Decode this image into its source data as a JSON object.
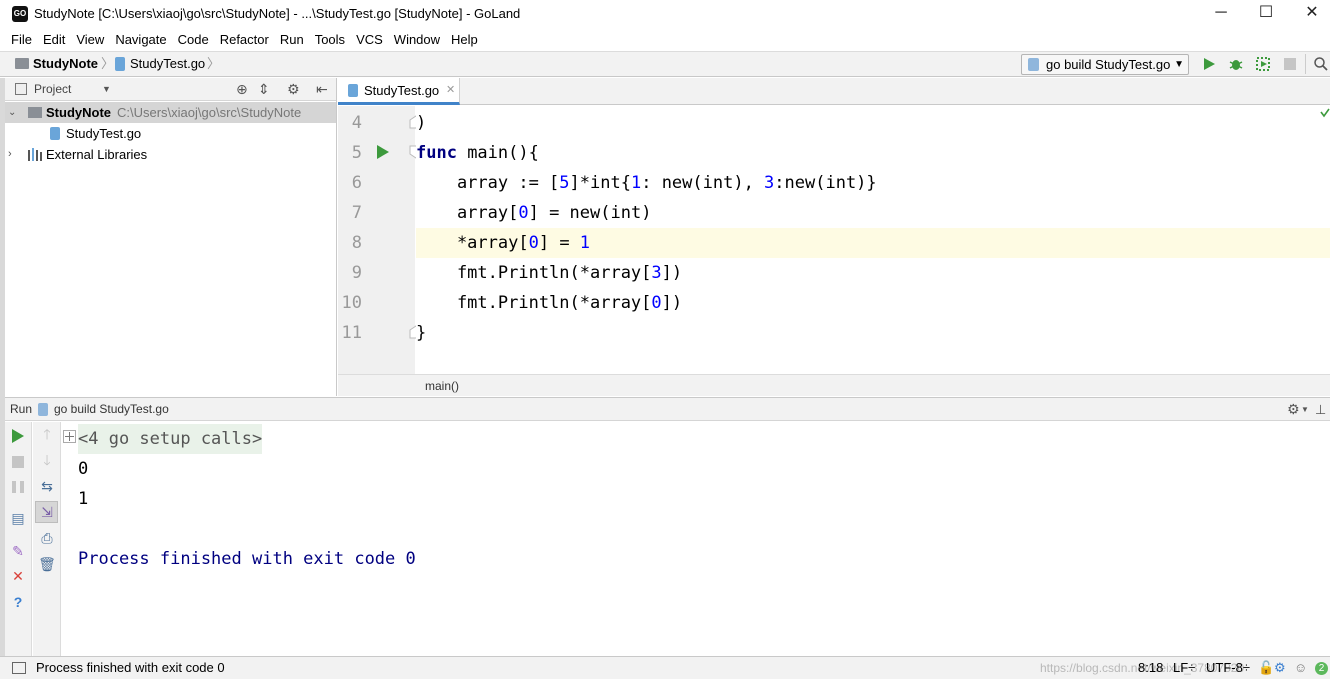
{
  "window": {
    "title": "StudyNote [C:\\Users\\xiaoj\\go\\src\\StudyNote] - ...\\StudyTest.go [StudyNote] - GoLand",
    "minimize": "─",
    "maximize": "☐",
    "close": "✕"
  },
  "menu": [
    "File",
    "Edit",
    "View",
    "Navigate",
    "Code",
    "Refactor",
    "Run",
    "Tools",
    "VCS",
    "Window",
    "Help"
  ],
  "navbar": {
    "project": "StudyNote",
    "file": "StudyTest.go",
    "run_config": "go build StudyTest.go"
  },
  "project_panel": {
    "title": "Project",
    "root_name": "StudyNote",
    "root_path": "C:\\Users\\xiaoj\\go\\src\\StudyNote",
    "file": "StudyTest.go",
    "libraries": "External Libraries"
  },
  "editor": {
    "tab": "StudyTest.go",
    "line_numbers": [
      "4",
      "5",
      "6",
      "7",
      "8",
      "9",
      "10",
      "11"
    ],
    "breadcrumb": "main()"
  },
  "run_panel": {
    "label": "Run",
    "config": "go build StudyTest.go",
    "setup_calls": "<4 go setup calls>",
    "output": [
      "0",
      "1"
    ],
    "finished": "Process finished with exit code 0"
  },
  "status": {
    "message": "Process finished with exit code 0",
    "position": "8:18",
    "line_sep": "LF÷",
    "encoding": "UTF-8÷",
    "watermark": "https://blog.csdn.net/weixin_37807820",
    "events_count": "2"
  },
  "colors": {
    "accent": "#4083c9",
    "keyword": "#000080",
    "number": "#0000ff",
    "run_green": "#3d9a3d",
    "current_line": "#fefbe3"
  }
}
